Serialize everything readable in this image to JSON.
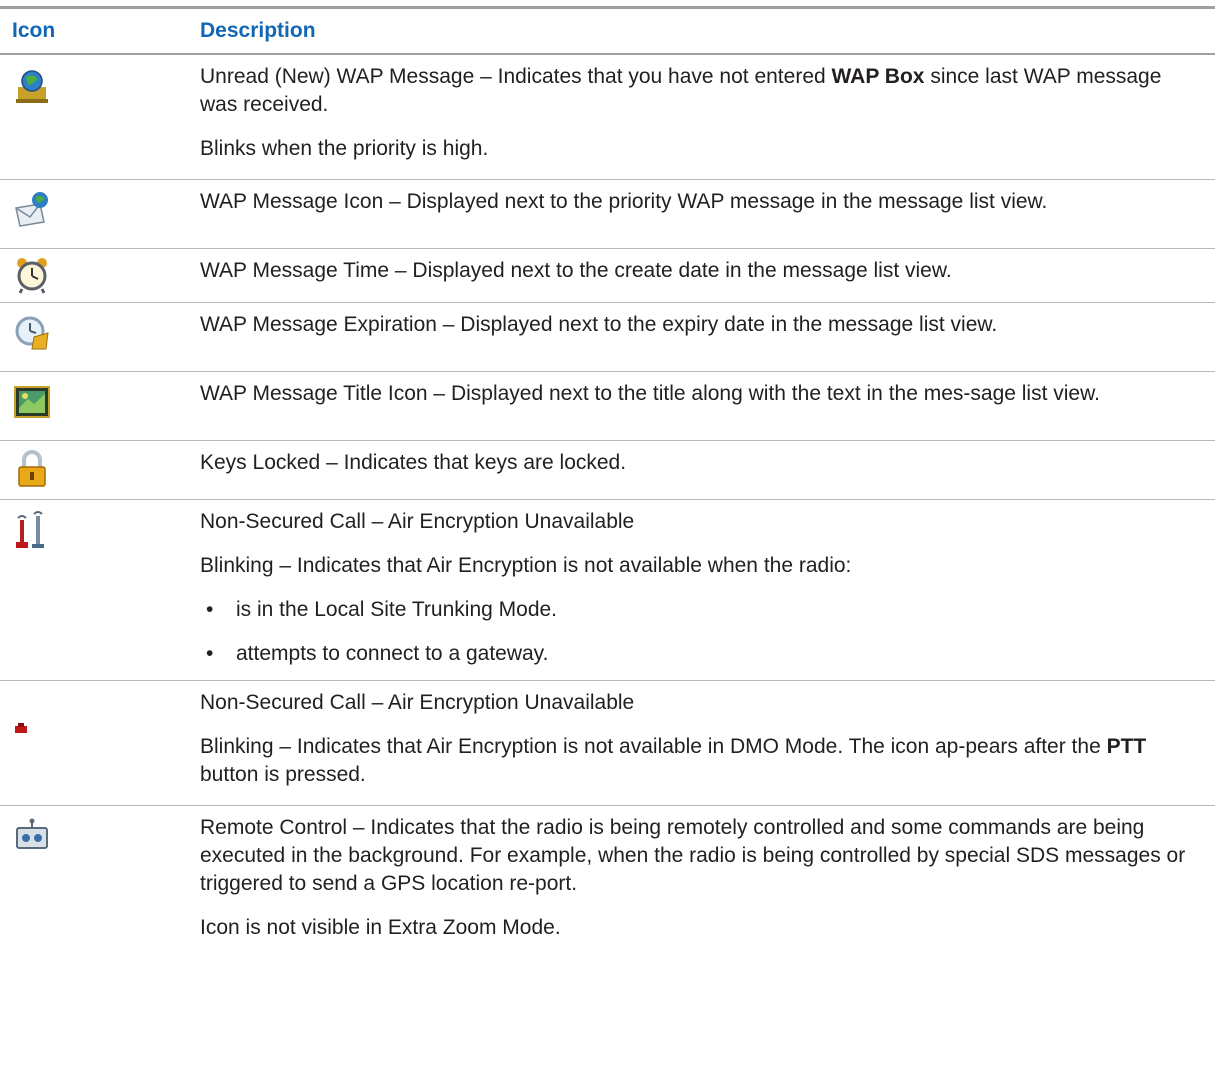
{
  "header": {
    "icon_col": "Icon",
    "desc_col": "Description"
  },
  "rows": [
    {
      "icon": "unread-wap-message-icon",
      "p1_pre": "Unread (New) WAP Message – Indicates that you have not entered ",
      "p1_bold": "WAP Box",
      "p1_post": " since last WAP message was received.",
      "p2": "Blinks when the priority is high."
    },
    {
      "icon": "wap-message-icon",
      "p1": "WAP Message Icon – Displayed next to the priority WAP message in the message list view."
    },
    {
      "icon": "alarm-clock-icon",
      "p1": "WAP Message Time – Displayed next to the create date in the message list view."
    },
    {
      "icon": "expiration-clock-icon",
      "p1": "WAP Message Expiration – Displayed next to the expiry date in the message list view."
    },
    {
      "icon": "title-picture-icon",
      "p1": "WAP Message Title Icon – Displayed next to the title along with the text in the mes-sage list view."
    },
    {
      "icon": "padlock-icon",
      "p1": "Keys Locked – Indicates that keys are locked."
    },
    {
      "icon": "non-secured-trunking-icon",
      "p1": "Non-Secured Call – Air Encryption Unavailable",
      "p2": "Blinking – Indicates that Air Encryption is not available when the radio:",
      "bullets": [
        "is in the Local Site Trunking Mode.",
        "attempts to connect to a gateway."
      ],
      "bullet_char": "•"
    },
    {
      "icon": "non-secured-dmo-icon",
      "p1": "Non-Secured Call – Air Encryption Unavailable",
      "p2_pre": "Blinking – Indicates that Air Encryption is not available in DMO Mode. The icon ap-pears after the ",
      "p2_bold": "PTT",
      "p2_post": " button is pressed."
    },
    {
      "icon": "remote-control-icon",
      "p1": "Remote Control – Indicates that the radio is being remotely controlled and some commands are being executed in the background. For example, when the radio is being controlled by special SDS messages or triggered to send a GPS location re-port.",
      "p2": "Icon is not visible in Extra Zoom Mode."
    }
  ]
}
